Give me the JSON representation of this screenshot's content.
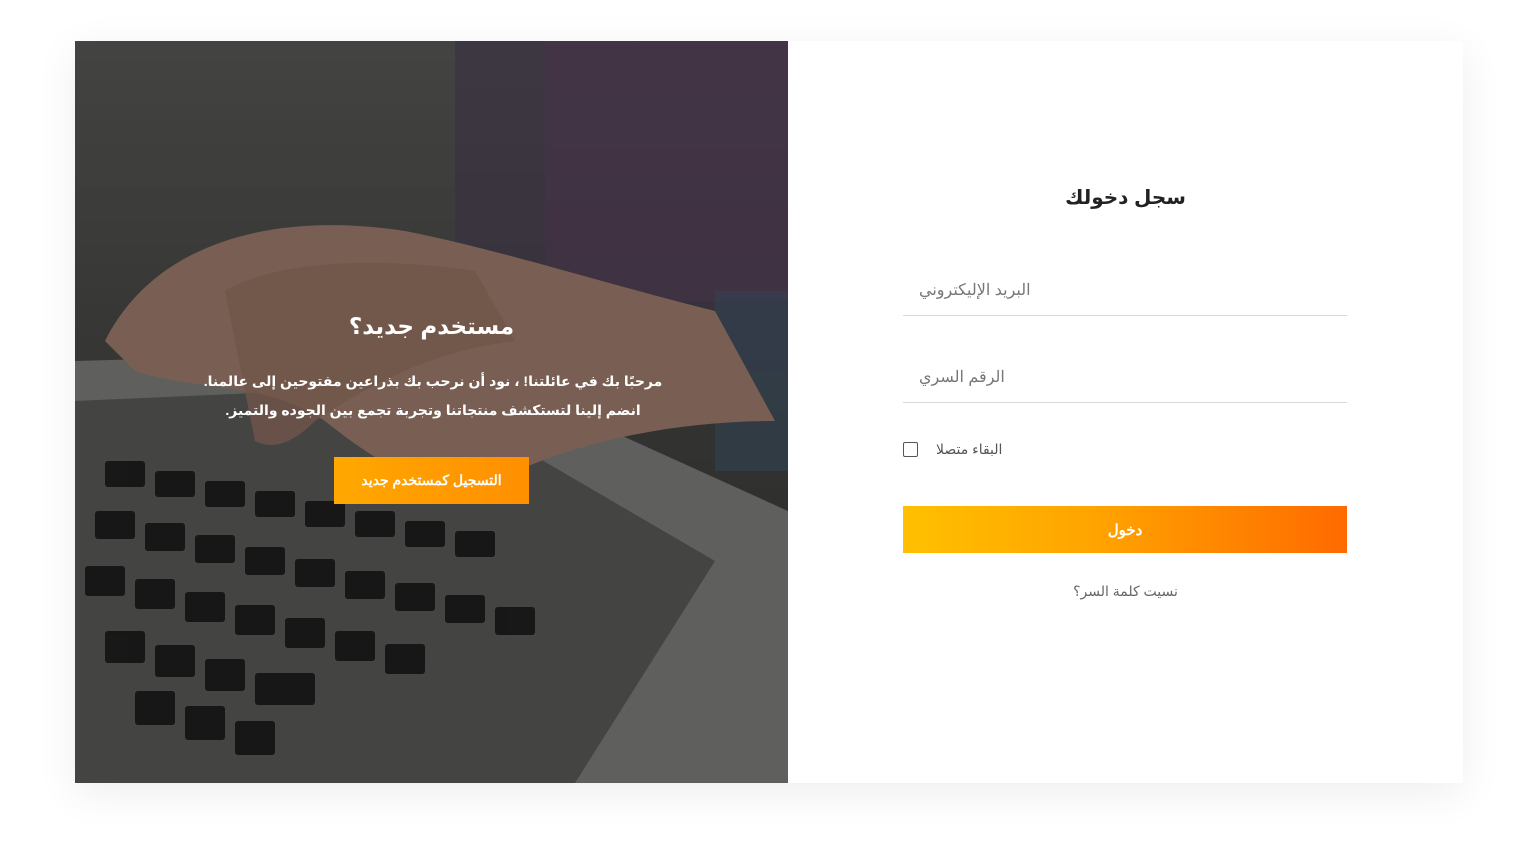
{
  "promo": {
    "title": "مستخدم جديد؟",
    "text": "مرحبًا بك في عائلتنا! ، نود أن نرحب بك بذراعين مفتوحين إلى عالمنا. انضم إلينا لتستكشف منتجاتنا وتجربة تجمع بين الجوده والتميز.",
    "button_label": "التسجيل كمستخدم جديد"
  },
  "login": {
    "title": "سجل دخولك",
    "email_placeholder": "البريد الإليكتروني",
    "password_placeholder": "الرقم السري",
    "remember_label": "البقاء متصلا",
    "remember_checked": false,
    "submit_label": "دخول",
    "forgot_label": "نسيت كلمة السر؟"
  },
  "colors": {
    "accent_start": "#ffc000",
    "accent_end": "#ff6a00"
  }
}
